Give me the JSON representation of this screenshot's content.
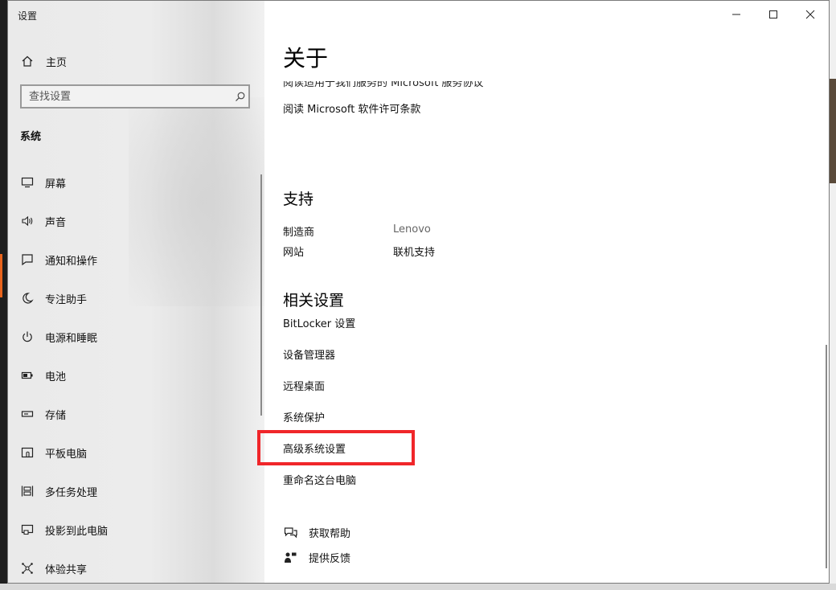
{
  "window": {
    "title": "设置"
  },
  "sidebar": {
    "home_label": "主页",
    "search_placeholder": "查找设置",
    "section_label": "系统",
    "items": [
      {
        "icon": "monitor-icon",
        "label": "屏幕"
      },
      {
        "icon": "speaker-icon",
        "label": "声音"
      },
      {
        "icon": "notification-icon",
        "label": "通知和操作"
      },
      {
        "icon": "moon-icon",
        "label": "专注助手"
      },
      {
        "icon": "power-icon",
        "label": "电源和睡眠"
      },
      {
        "icon": "battery-icon",
        "label": "电池"
      },
      {
        "icon": "storage-icon",
        "label": "存储"
      },
      {
        "icon": "tablet-icon",
        "label": "平板电脑"
      },
      {
        "icon": "multitask-icon",
        "label": "多任务处理"
      },
      {
        "icon": "project-icon",
        "label": "投影到此电脑"
      },
      {
        "icon": "share-icon",
        "label": "体验共享"
      }
    ]
  },
  "content": {
    "title": "关于",
    "cut_off_link": "阅读适用于我们服务的 Microsoft 服务协议",
    "license_link": "阅读 Microsoft 软件许可条款",
    "support": {
      "heading": "支持",
      "manufacturer_key": "制造商",
      "manufacturer_value": "Lenovo",
      "website_key": "网站",
      "website_value": "联机支持"
    },
    "related": {
      "heading": "相关设置",
      "links": [
        "BitLocker 设置",
        "设备管理器",
        "远程桌面",
        "系统保护",
        "高级系统设置",
        "重命名这台电脑"
      ]
    },
    "help": {
      "get_help": "获取帮助",
      "feedback": "提供反馈"
    }
  },
  "colors": {
    "highlight": "#f0262a",
    "taskbar_accent": "#e8631c"
  }
}
